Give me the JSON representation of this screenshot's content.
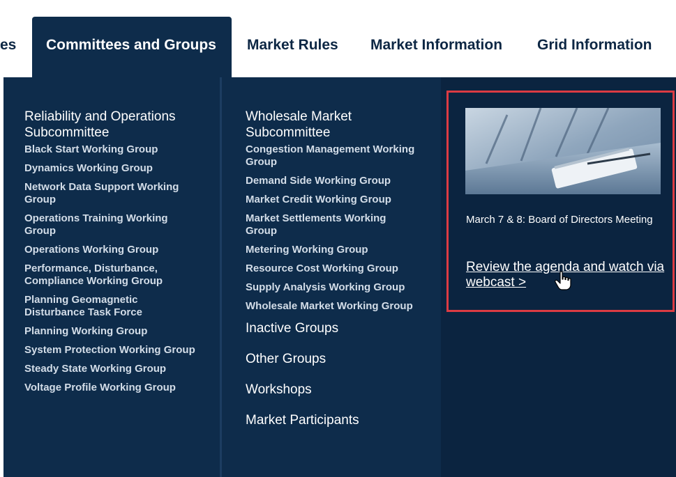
{
  "nav": {
    "partial_item": "es",
    "active_item": "Committees and Groups",
    "items": [
      "Market Rules",
      "Market Information",
      "Grid Information"
    ]
  },
  "column1": {
    "heading": "Reliability and Operations Subcommittee",
    "links": [
      "Black Start Working Group",
      "Dynamics Working Group",
      "Network Data Support Working Group",
      "Operations Training Working Group",
      "Operations Working Group",
      "Performance, Disturbance, Compliance Working Group",
      "Planning Geomagnetic Disturbance Task Force",
      "Planning Working Group",
      "System Protection Working Group",
      "Steady State Working Group",
      "Voltage Profile Working Group"
    ]
  },
  "column2": {
    "heading": "Wholesale Market Subcommittee",
    "links": [
      "Congestion Management Working Group",
      "Demand Side Working Group",
      "Market Credit Working Group",
      "Market Settlements Working Group",
      "Metering Working Group",
      "Resource Cost Working Group",
      "Supply Analysis Working Group",
      "Wholesale Market Working Group"
    ],
    "big_links": [
      "Inactive Groups",
      "Other Groups",
      "Workshops",
      "Market Participants"
    ]
  },
  "feature": {
    "caption": "March 7 & 8: Board of Directors Meeting",
    "link": "Review the agenda and watch via webcast >",
    "image_icon": "boardroom-photo",
    "cursor_icon": "hand-pointer-icon"
  },
  "colors": {
    "panel_bg": "#0e2c4b",
    "nav_text": "#0d2744",
    "highlight_border": "#dc3b43"
  }
}
